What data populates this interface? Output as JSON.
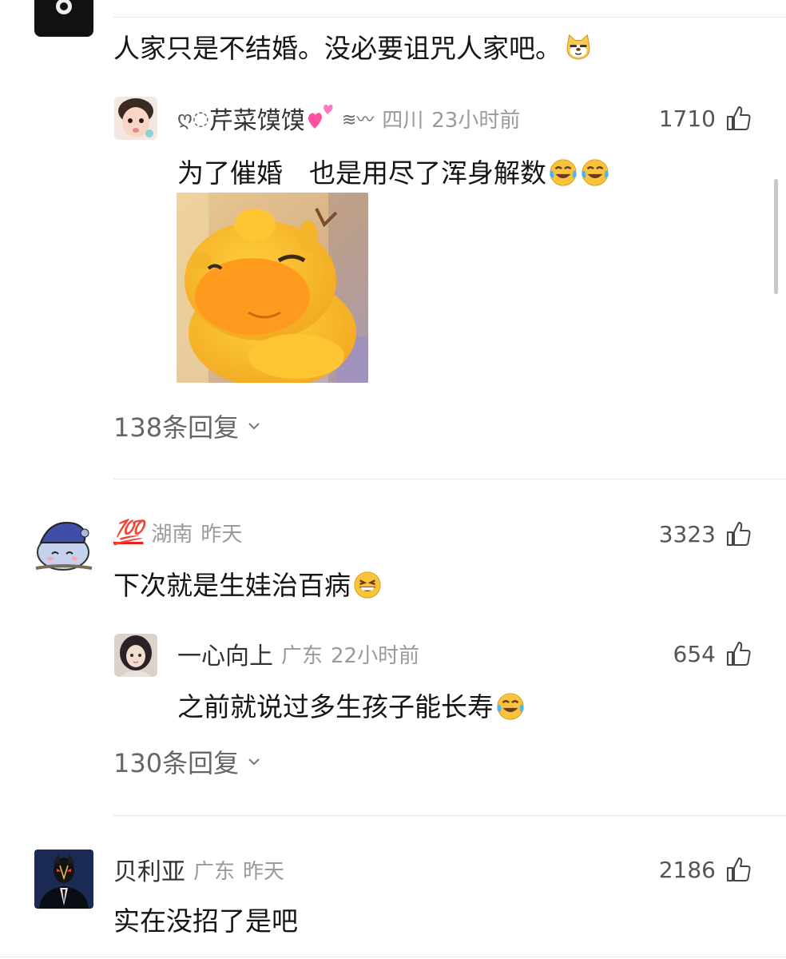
{
  "comments": [
    {
      "text": "人家只是不结婚。没必要诅咒人家吧。",
      "emoji": "cat-face-emoji",
      "reply": {
        "prefix": "ღ◌",
        "name": "芹菜馍馍",
        "suffix": "≋︎〰",
        "location": "四川",
        "time": "23小时前",
        "likes": "1710",
        "text": "为了催婚　也是用尽了浑身解数",
        "emoji": "tears-of-joy-emoji"
      },
      "more_replies": "138条回复"
    },
    {
      "name": "💯",
      "location": "湖南",
      "time": "昨天",
      "likes": "3323",
      "text": "下次就是生娃治百病",
      "emoji": "grinning-sweat-emoji",
      "reply": {
        "name": "一心向上",
        "location": "广东",
        "time": "22小时前",
        "likes": "654",
        "text": "之前就说过多生孩子能长寿",
        "emoji": "tears-of-joy-emoji"
      },
      "more_replies": "130条回复"
    },
    {
      "name": "贝利亚",
      "location": "广东",
      "time": "昨天",
      "likes": "2186",
      "text": "实在没招了是吧"
    }
  ],
  "colors": {
    "meta": "#9a9a9a",
    "divider": "#e6e6e6",
    "heart_pink": "#ff4fa0",
    "hundred_red": "#e0221b"
  }
}
